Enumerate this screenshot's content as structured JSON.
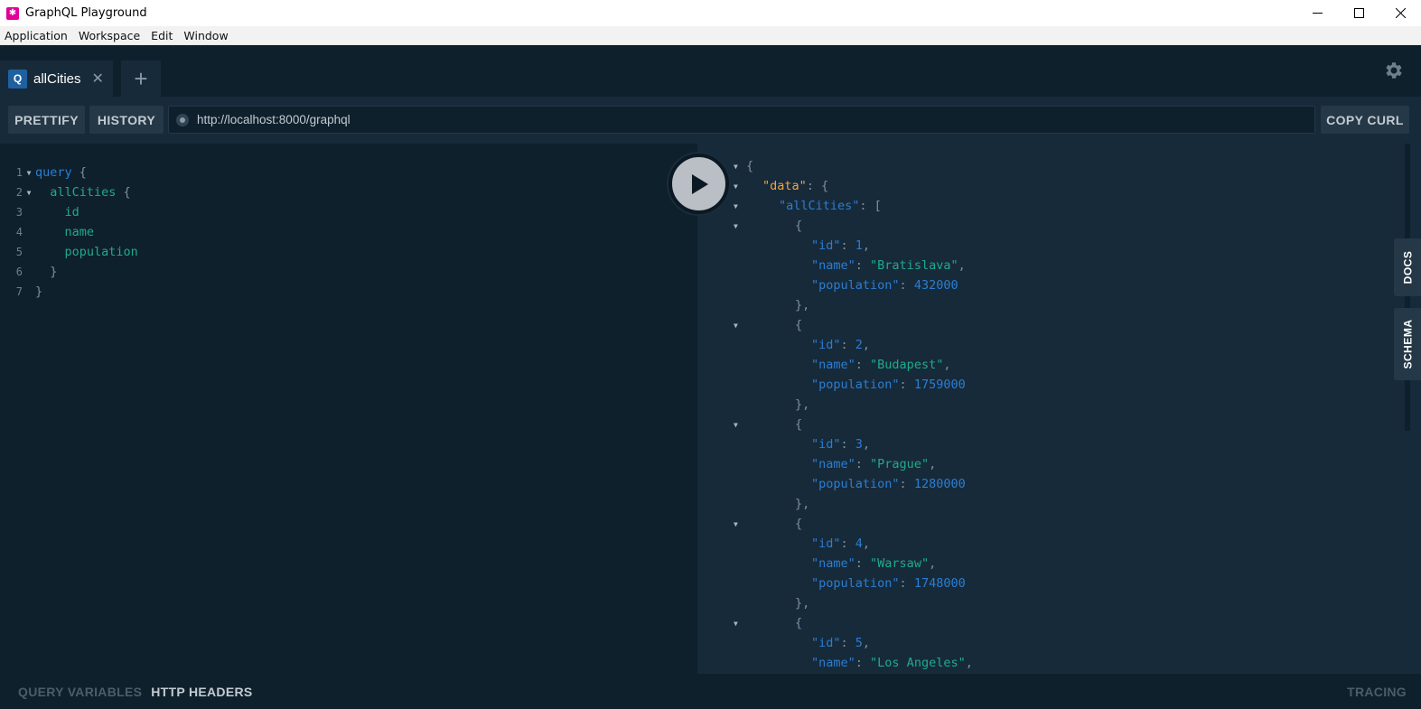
{
  "window": {
    "title": "GraphQL Playground",
    "controls": [
      "minimize-icon",
      "maximize-icon",
      "close-icon"
    ]
  },
  "menu": {
    "items": [
      "Application",
      "Workspace",
      "Edit",
      "Window"
    ]
  },
  "tabs": {
    "active": {
      "badge": "Q",
      "label": "allCities",
      "close": "✕"
    },
    "add_label": "+"
  },
  "toolbar": {
    "prettify": "PRETTIFY",
    "history": "HISTORY",
    "url": "http://localhost:8000/graphql",
    "copy_curl": "COPY CURL"
  },
  "editor": {
    "lines": [
      {
        "num": "1",
        "fold": true,
        "indent": "",
        "parts": [
          {
            "t": "query",
            "c": "kw"
          },
          {
            "t": " {",
            "c": "punc"
          }
        ]
      },
      {
        "num": "2",
        "fold": true,
        "indent": "  ",
        "parts": [
          {
            "t": "allCities",
            "c": "field"
          },
          {
            "t": " {",
            "c": "punc"
          }
        ]
      },
      {
        "num": "3",
        "fold": false,
        "indent": "    ",
        "parts": [
          {
            "t": "id",
            "c": "field"
          }
        ]
      },
      {
        "num": "4",
        "fold": false,
        "indent": "    ",
        "parts": [
          {
            "t": "name",
            "c": "field"
          }
        ]
      },
      {
        "num": "5",
        "fold": false,
        "indent": "    ",
        "parts": [
          {
            "t": "population",
            "c": "field"
          }
        ]
      },
      {
        "num": "6",
        "fold": false,
        "indent": "  ",
        "parts": [
          {
            "t": "}",
            "c": "punc"
          }
        ]
      },
      {
        "num": "7",
        "fold": false,
        "indent": "",
        "parts": [
          {
            "t": "}",
            "c": "punc"
          }
        ]
      }
    ]
  },
  "result": {
    "lines": [
      {
        "fold": true,
        "indent": 0,
        "parts": [
          {
            "t": "{",
            "c": "punc"
          }
        ]
      },
      {
        "fold": true,
        "indent": 1,
        "parts": [
          {
            "t": "\"data\"",
            "c": "key-data"
          },
          {
            "t": ": {",
            "c": "punc"
          }
        ]
      },
      {
        "fold": true,
        "indent": 2,
        "parts": [
          {
            "t": "\"allCities\"",
            "c": "key"
          },
          {
            "t": ": [",
            "c": "punc"
          }
        ]
      },
      {
        "fold": true,
        "indent": 3,
        "parts": [
          {
            "t": "{",
            "c": "punc"
          }
        ]
      },
      {
        "fold": false,
        "indent": 4,
        "parts": [
          {
            "t": "\"id\"",
            "c": "key"
          },
          {
            "t": ": ",
            "c": "punc"
          },
          {
            "t": "1",
            "c": "num"
          },
          {
            "t": ",",
            "c": "punc"
          }
        ]
      },
      {
        "fold": false,
        "indent": 4,
        "parts": [
          {
            "t": "\"name\"",
            "c": "key"
          },
          {
            "t": ": ",
            "c": "punc"
          },
          {
            "t": "\"Bratislava\"",
            "c": "str"
          },
          {
            "t": ",",
            "c": "punc"
          }
        ]
      },
      {
        "fold": false,
        "indent": 4,
        "parts": [
          {
            "t": "\"population\"",
            "c": "key"
          },
          {
            "t": ": ",
            "c": "punc"
          },
          {
            "t": "432000",
            "c": "num"
          }
        ]
      },
      {
        "fold": false,
        "indent": 3,
        "parts": [
          {
            "t": "},",
            "c": "punc"
          }
        ]
      },
      {
        "fold": true,
        "indent": 3,
        "parts": [
          {
            "t": "{",
            "c": "punc"
          }
        ]
      },
      {
        "fold": false,
        "indent": 4,
        "parts": [
          {
            "t": "\"id\"",
            "c": "key"
          },
          {
            "t": ": ",
            "c": "punc"
          },
          {
            "t": "2",
            "c": "num"
          },
          {
            "t": ",",
            "c": "punc"
          }
        ]
      },
      {
        "fold": false,
        "indent": 4,
        "parts": [
          {
            "t": "\"name\"",
            "c": "key"
          },
          {
            "t": ": ",
            "c": "punc"
          },
          {
            "t": "\"Budapest\"",
            "c": "str"
          },
          {
            "t": ",",
            "c": "punc"
          }
        ]
      },
      {
        "fold": false,
        "indent": 4,
        "parts": [
          {
            "t": "\"population\"",
            "c": "key"
          },
          {
            "t": ": ",
            "c": "punc"
          },
          {
            "t": "1759000",
            "c": "num"
          }
        ]
      },
      {
        "fold": false,
        "indent": 3,
        "parts": [
          {
            "t": "},",
            "c": "punc"
          }
        ]
      },
      {
        "fold": true,
        "indent": 3,
        "parts": [
          {
            "t": "{",
            "c": "punc"
          }
        ]
      },
      {
        "fold": false,
        "indent": 4,
        "parts": [
          {
            "t": "\"id\"",
            "c": "key"
          },
          {
            "t": ": ",
            "c": "punc"
          },
          {
            "t": "3",
            "c": "num"
          },
          {
            "t": ",",
            "c": "punc"
          }
        ]
      },
      {
        "fold": false,
        "indent": 4,
        "parts": [
          {
            "t": "\"name\"",
            "c": "key"
          },
          {
            "t": ": ",
            "c": "punc"
          },
          {
            "t": "\"Prague\"",
            "c": "str"
          },
          {
            "t": ",",
            "c": "punc"
          }
        ]
      },
      {
        "fold": false,
        "indent": 4,
        "parts": [
          {
            "t": "\"population\"",
            "c": "key"
          },
          {
            "t": ": ",
            "c": "punc"
          },
          {
            "t": "1280000",
            "c": "num"
          }
        ]
      },
      {
        "fold": false,
        "indent": 3,
        "parts": [
          {
            "t": "},",
            "c": "punc"
          }
        ]
      },
      {
        "fold": true,
        "indent": 3,
        "parts": [
          {
            "t": "{",
            "c": "punc"
          }
        ]
      },
      {
        "fold": false,
        "indent": 4,
        "parts": [
          {
            "t": "\"id\"",
            "c": "key"
          },
          {
            "t": ": ",
            "c": "punc"
          },
          {
            "t": "4",
            "c": "num"
          },
          {
            "t": ",",
            "c": "punc"
          }
        ]
      },
      {
        "fold": false,
        "indent": 4,
        "parts": [
          {
            "t": "\"name\"",
            "c": "key"
          },
          {
            "t": ": ",
            "c": "punc"
          },
          {
            "t": "\"Warsaw\"",
            "c": "str"
          },
          {
            "t": ",",
            "c": "punc"
          }
        ]
      },
      {
        "fold": false,
        "indent": 4,
        "parts": [
          {
            "t": "\"population\"",
            "c": "key"
          },
          {
            "t": ": ",
            "c": "punc"
          },
          {
            "t": "1748000",
            "c": "num"
          }
        ]
      },
      {
        "fold": false,
        "indent": 3,
        "parts": [
          {
            "t": "},",
            "c": "punc"
          }
        ]
      },
      {
        "fold": true,
        "indent": 3,
        "parts": [
          {
            "t": "{",
            "c": "punc"
          }
        ]
      },
      {
        "fold": false,
        "indent": 4,
        "parts": [
          {
            "t": "\"id\"",
            "c": "key"
          },
          {
            "t": ": ",
            "c": "punc"
          },
          {
            "t": "5",
            "c": "num"
          },
          {
            "t": ",",
            "c": "punc"
          }
        ]
      },
      {
        "fold": false,
        "indent": 4,
        "parts": [
          {
            "t": "\"name\"",
            "c": "key"
          },
          {
            "t": ": ",
            "c": "punc"
          },
          {
            "t": "\"Los Angeles\"",
            "c": "str"
          },
          {
            "t": ",",
            "c": "punc"
          }
        ]
      }
    ]
  },
  "side_tabs": {
    "docs": "DOCS",
    "schema": "SCHEMA"
  },
  "bottom": {
    "query_variables": "QUERY VARIABLES",
    "http_headers": "HTTP HEADERS",
    "tracing": "TRACING"
  },
  "colors": {
    "accent": "#e10098",
    "keyword": "#2a7ed3",
    "field": "#1fab8a",
    "data_key": "#f5a33c"
  }
}
